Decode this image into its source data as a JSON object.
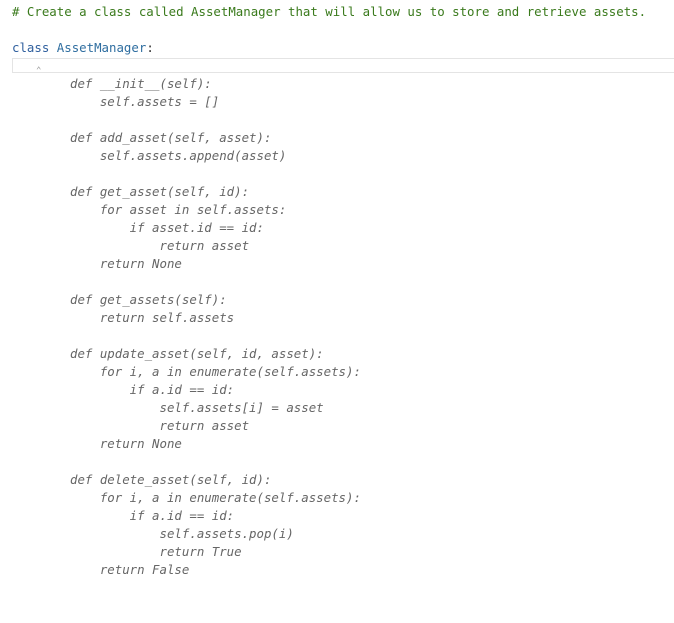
{
  "editor": {
    "comment": "# Create a class called AssetManager that will allow us to store and retrieve assets.",
    "class_keyword": "class",
    "class_name": "AssetManager",
    "class_colon": ":",
    "suggestion_lines": [
      "def __init__(self):",
      "    self.assets = []",
      "",
      "def add_asset(self, asset):",
      "    self.assets.append(asset)",
      "",
      "def get_asset(self, id):",
      "    for asset in self.assets:",
      "        if asset.id == id:",
      "            return asset",
      "    return None",
      "",
      "def get_assets(self):",
      "    return self.assets",
      "",
      "def update_asset(self, id, asset):",
      "    for i, a in enumerate(self.assets):",
      "        if a.id == id:",
      "            self.assets[i] = asset",
      "            return asset",
      "    return None",
      "",
      "def delete_asset(self, id):",
      "    for i, a in enumerate(self.assets):",
      "        if a.id == id:",
      "            self.assets.pop(i)",
      "            return True",
      "    return False"
    ]
  }
}
